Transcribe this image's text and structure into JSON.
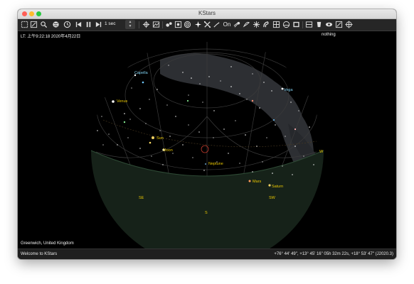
{
  "window": {
    "title": "KStars"
  },
  "toolbar": {
    "time_step": "1 sec",
    "icons": [
      "zoom-fit-icon",
      "zoom-icon",
      "search-icon",
      "globe-icon",
      "clock-icon",
      "step-back-icon",
      "pause-icon",
      "step-forward-icon",
      "telescope-icon",
      "image-icon",
      "binoculars-icon",
      "filter-icon",
      "target-icon",
      "star-icon",
      "constellation-lines-icon",
      "asteroid-icon",
      "constellation-names-icon",
      "comet-icon",
      "satellite-icon",
      "supernova-icon",
      "nebula-icon",
      "grid-icon",
      "horizon-icon",
      "flag-icon",
      "eye-icon",
      "sky-icon",
      "crosshair-icon"
    ]
  },
  "sky": {
    "local_time": "LT: 上午9:22:18   2020年4月22日",
    "focus_object": "nothing",
    "location": "Greenwich, United Kingdom",
    "labels": [
      {
        "text": "Capella",
        "color": "#7fd0f0"
      },
      {
        "text": "Vega",
        "color": "#7fd0f0"
      },
      {
        "text": "Venus",
        "color": "#e8c600"
      },
      {
        "text": "Sun",
        "color": "#e8c600"
      },
      {
        "text": "Moon",
        "color": "#e8c600"
      },
      {
        "text": "Neptune",
        "color": "#e8c600"
      },
      {
        "text": "Mars",
        "color": "#e8c600"
      },
      {
        "text": "Saturn",
        "color": "#e8c600"
      }
    ],
    "compass": [
      {
        "text": "W"
      },
      {
        "text": "SE"
      },
      {
        "text": "SW"
      },
      {
        "text": "S"
      }
    ]
  },
  "status": {
    "message": "Welcome to KStars",
    "coordinates": "+76° 44' 49\", +13° 45' 16\"  05h 32m 22s, +18° 53' 47\" (J2020.3)"
  }
}
